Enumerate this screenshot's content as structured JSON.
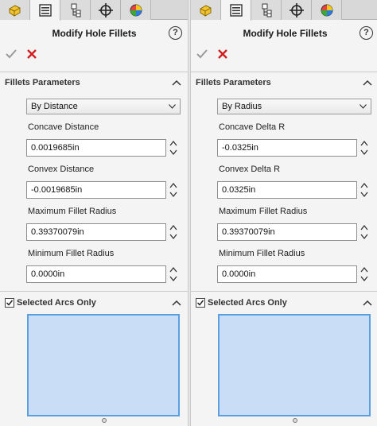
{
  "left": {
    "title": "Modify Hole Fillets",
    "help": "?",
    "section_fillets": "Fillets Parameters",
    "mode": "By Distance",
    "fields": [
      {
        "label": "Concave Distance",
        "value": "0.0019685in"
      },
      {
        "label": "Convex Distance",
        "value": "-0.0019685in"
      },
      {
        "label": "Maximum Fillet Radius",
        "value": "0.39370079in"
      },
      {
        "label": "Minimum Fillet Radius",
        "value": "0.0000in"
      }
    ],
    "selected_arcs_label": "Selected Arcs Only",
    "selected_arcs_checked": true
  },
  "right": {
    "title": "Modify Hole Fillets",
    "help": "?",
    "section_fillets": "Fillets Parameters",
    "mode": "By Radius",
    "fields": [
      {
        "label": "Concave Delta R",
        "value": "-0.0325in"
      },
      {
        "label": "Convex Delta R",
        "value": "0.0325in"
      },
      {
        "label": "Maximum Fillet Radius",
        "value": "0.39370079in"
      },
      {
        "label": "Minimum Fillet Radius",
        "value": "0.0000in"
      }
    ],
    "selected_arcs_label": "Selected Arcs Only",
    "selected_arcs_checked": true
  },
  "tabs": [
    "feature-manager-icon",
    "property-manager-icon",
    "configuration-manager-icon",
    "dimxpert-icon",
    "display-manager-icon"
  ],
  "active_tab": 1,
  "colors": {
    "ok": "#9a9a9a",
    "cancel": "#d21f1f",
    "list_fill": "#c9def6",
    "list_border": "#5a9fe0"
  }
}
